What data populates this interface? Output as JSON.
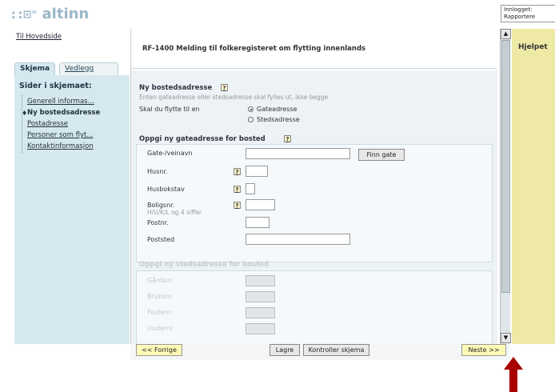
{
  "header": {
    "logo_mark": "::⊡⁼",
    "logo_text": "altinn",
    "login_line1": "Innlogget:",
    "login_line2": "Rapportere",
    "home_link": "Til Hovedside"
  },
  "tabs": [
    {
      "label": "Skjema",
      "active": true
    },
    {
      "label": "Vedlegg",
      "active": false
    }
  ],
  "sidebar": {
    "title": "Sider i skjemaet:",
    "items": [
      {
        "label": "Generell informas...",
        "active": false
      },
      {
        "label": "Ny bostedsadresse",
        "active": true
      },
      {
        "label": "Postadresse",
        "active": false
      },
      {
        "label": "Personer som flyt...",
        "active": false
      },
      {
        "label": "Kontaktinformasjon",
        "active": false
      }
    ]
  },
  "form": {
    "title": "RF-1400 Melding til folkeregisteret om flytting innenlands",
    "section1": {
      "heading": "Ny bostedsadresse",
      "help": "?",
      "hint": "Enten gateadresse eller stedsadresse skal fylles ut, ikke begge",
      "question": "Skal du flytte til en",
      "options": [
        {
          "label": "Gateadresse",
          "selected": true
        },
        {
          "label": "Stedsadresse",
          "selected": false
        }
      ]
    },
    "section2": {
      "heading": "Oppgi ny gateadresse for bosted",
      "help": "?",
      "fields": {
        "street": {
          "label": "Gate-/veinavn",
          "value": ""
        },
        "find_button": "Finn gate",
        "house_no": {
          "label": "Husnr.",
          "value": ""
        },
        "house_letter": {
          "label": "Husbokstav",
          "value": ""
        },
        "apartment": {
          "label": "Boligsnr.",
          "hint": "H/U/K/L og 4 siffer",
          "value": ""
        },
        "postal_no": {
          "label": "Postnr.",
          "value": ""
        },
        "postal_place": {
          "label": "Poststed",
          "value": ""
        }
      }
    },
    "section3": {
      "heading": "Oppgi ny stedsadresse for bosted",
      "fields": [
        "Gårdsnr.",
        "Bruksnr.",
        "Festenr.",
        "Undernr."
      ]
    }
  },
  "help_panel": {
    "title": "Hjelpet"
  },
  "footer": {
    "prev": "<< Forrige",
    "save": "Lagre",
    "validate": "Kontroller skjema",
    "next": "Neste >>"
  },
  "scrollbar": {
    "up": "▲",
    "down": "▼"
  },
  "colors": {
    "sidebar_bg": "#d6e8ef",
    "help_bg": "#eeeaa6",
    "annotation_arrow": "#a80000"
  }
}
